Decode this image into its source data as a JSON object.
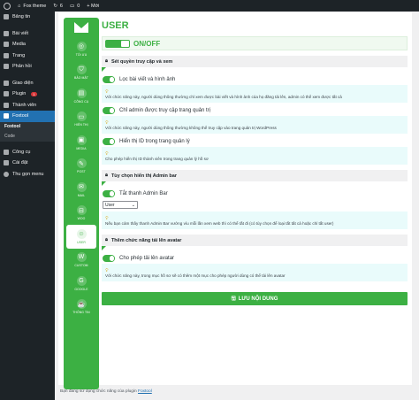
{
  "adminbar": {
    "site_name": "Fox theme",
    "updates": "6",
    "comments": "0",
    "new_label": "+ Mới"
  },
  "sidebar": {
    "items": [
      {
        "label": "Bảng tin",
        "icon": "dashboard-icon"
      },
      {
        "label": "Bài viết",
        "icon": "pin-icon"
      },
      {
        "label": "Media",
        "icon": "media-icon"
      },
      {
        "label": "Trang",
        "icon": "page-icon"
      },
      {
        "label": "Phản hồi",
        "icon": "comment-icon"
      },
      {
        "label": "Giao diện",
        "icon": "brush-icon"
      },
      {
        "label": "Plugin",
        "icon": "plugin-icon",
        "badge": "1"
      },
      {
        "label": "Thành viên",
        "icon": "user-icon"
      },
      {
        "label": "Foxtool",
        "icon": "foxtool-icon",
        "active": true
      },
      {
        "label": "Công cụ",
        "icon": "wrench-icon"
      },
      {
        "label": "Cài đặt",
        "icon": "settings-icon"
      },
      {
        "label": "Thu gọn menu",
        "icon": "collapse-icon"
      }
    ],
    "submenu": [
      "Foxtool",
      "Code"
    ]
  },
  "vnav": {
    "items": [
      "TỐI ƯU",
      "BẢO MẬT",
      "CÔNG CỤ",
      "HIỂN THỊ",
      "MEDIA",
      "POST",
      "MAIL",
      "WOO",
      "USER",
      "CUSTOM",
      "GOOGLE",
      "THÔNG TIN"
    ],
    "active": "USER"
  },
  "page": {
    "title": "USER",
    "onoff_label": "ON/OFF",
    "sections": [
      {
        "title": "Sét quyền truy cập và xem",
        "options": [
          {
            "label": "Lọc bài viết và hình ảnh",
            "desc": "Với chức năng này, người dùng thông thường chỉ xem được bài viết và hình ảnh của họ đăng tải lên, admin có thể xem được tất cả"
          },
          {
            "label": "Chỉ admin được truy cập trang quản trị",
            "desc": "Với chức năng này, người dùng thông thường không thể truy cập vào trang quản trị WordPress"
          },
          {
            "label": "Hiển thị ID trong trang quản lý",
            "desc": "Cho phép hiển thị ID thành viên trong trang quản lý hồ sơ"
          }
        ]
      },
      {
        "title": "Tùy chọn hiển thị Admin bar",
        "options": [
          {
            "label": "Tắt thanh Admin Bar",
            "select_value": "User",
            "desc": "Nếu bạn cảm thấy thanh Admin Bar vướng víu mỗi lần xem web thì có thể tắt đi (có tùy chọn để loại tắt tất cả hoặc chỉ tắt user)"
          }
        ]
      },
      {
        "title": "Thêm chức năng tải lên avatar",
        "options": [
          {
            "label": "Cho phép tải lên avatar",
            "desc": "Với chức năng này, trong mục hồ sơ sẽ có thêm một mục cho phép người dùng có thể tải lên avatar"
          }
        ]
      }
    ],
    "save_label": "LƯU NỘI DUNG"
  },
  "footer": {
    "text": "Bạn đang sử dụng chức năng của plugin",
    "link": "Foxtool"
  },
  "colors": {
    "accent": "#3cb043",
    "admin_dark": "#1d2327",
    "active_blue": "#2271b1",
    "desc_bg": "#e9fbfb"
  }
}
